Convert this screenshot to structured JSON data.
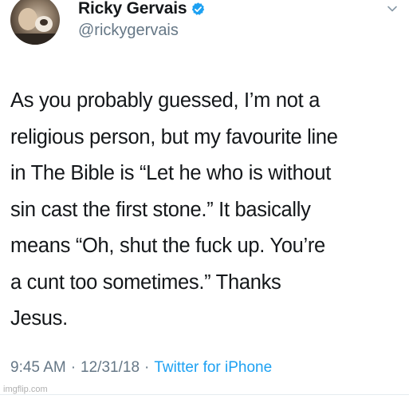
{
  "author": {
    "display_name": "Ricky Gervais",
    "handle": "@rickygervais",
    "verified": true
  },
  "tweet": {
    "lines": [
      "As you probably guessed, I’m not a",
      "religious person, but my favourite line",
      "in The Bible is “Let he who is without",
      "sin cast the first stone.” It basically",
      "means “Oh, shut the fuck up. You’re",
      "a cunt too sometimes.” Thanks",
      "Jesus."
    ]
  },
  "meta": {
    "time": "9:45 AM",
    "date": "12/31/18",
    "source": "Twitter for iPhone",
    "separator": "·"
  },
  "watermark": "imgflip.com",
  "colors": {
    "name": "#14171a",
    "secondary": "#657786",
    "link": "#1da1f2",
    "verified": "#1da1f2"
  }
}
